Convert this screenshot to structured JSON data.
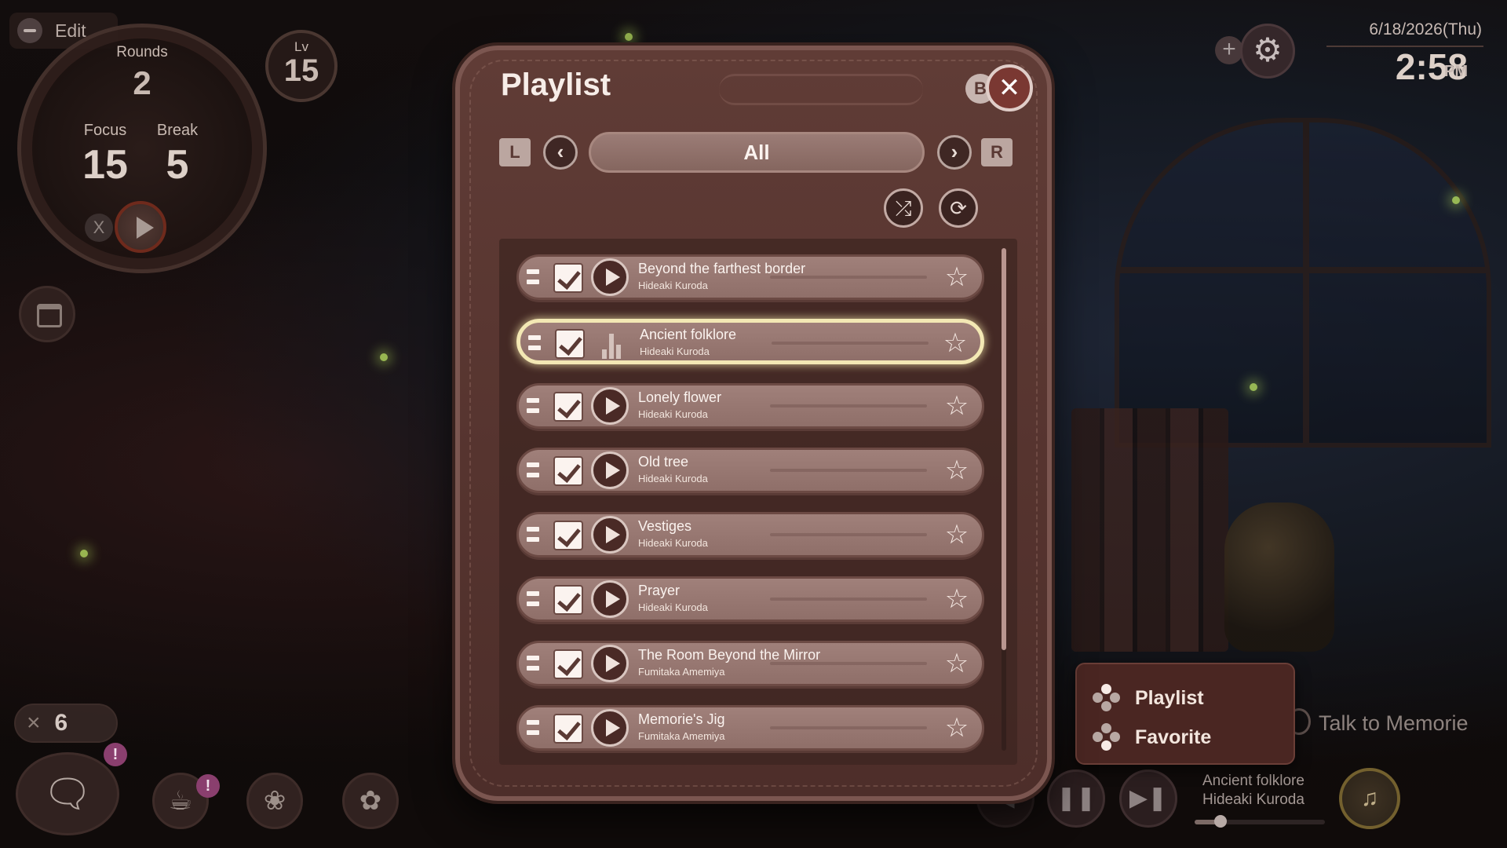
{
  "hud": {
    "edit_label": "Edit",
    "rounds_label": "Rounds",
    "rounds_value": "2",
    "focus_label": "Focus",
    "focus_value": "15",
    "break_label": "Break",
    "break_value": "5",
    "level_label": "Lv",
    "level_value": "15",
    "keys_count": "6",
    "stop_glyph": "X",
    "keys_glyph": "×"
  },
  "clock": {
    "date": "6/18/2026(Thu)",
    "time": "2:58",
    "ampm": "PM"
  },
  "playlist_modal": {
    "title": "Playlist",
    "close_hint": "B",
    "left_key": "L",
    "right_key": "R",
    "filter": "All",
    "tracks": [
      {
        "title": "Beyond the farthest border",
        "artist": "Hideaki Kuroda",
        "playing": false
      },
      {
        "title": "Ancient folklore",
        "artist": "Hideaki Kuroda",
        "playing": true
      },
      {
        "title": "Lonely flower",
        "artist": "Hideaki Kuroda",
        "playing": false
      },
      {
        "title": "Old tree",
        "artist": "Hideaki Kuroda",
        "playing": false
      },
      {
        "title": "Vestiges",
        "artist": "Hideaki Kuroda",
        "playing": false
      },
      {
        "title": "Prayer",
        "artist": "Hideaki Kuroda",
        "playing": false
      },
      {
        "title": "The Room Beyond the Mirror",
        "artist": "Fumitaka Amemiya",
        "playing": false
      },
      {
        "title": "Memorie's Jig",
        "artist": "Fumitaka Amemiya",
        "playing": false
      }
    ]
  },
  "music_menu": {
    "items": [
      "Playlist",
      "Favorite"
    ]
  },
  "talk_label": "Talk to Memorie",
  "now_playing": {
    "title": "Ancient folklore",
    "artist": "Hideaki Kuroda",
    "progress": 0.2
  },
  "colors": {
    "modal_bg": "#5a3632",
    "row_bg": "#977770",
    "selected_outline": "#f3e8b4",
    "alert": "#8a3f6e"
  },
  "icons": [
    "minus-icon",
    "play-icon",
    "calendar-icon",
    "key-icon",
    "chat-clock-icon",
    "tea-cup-icon",
    "paw-icon",
    "acorn-icon",
    "plus-icon",
    "gear-icon",
    "close-icon",
    "chevron-left-icon",
    "chevron-right-icon",
    "shuffle-icon",
    "repeat-icon",
    "drag-handle-icon",
    "checkbox-icon",
    "equalizer-icon",
    "star-icon",
    "dpad-icon",
    "pause-icon",
    "next-icon",
    "music-note-icon"
  ]
}
